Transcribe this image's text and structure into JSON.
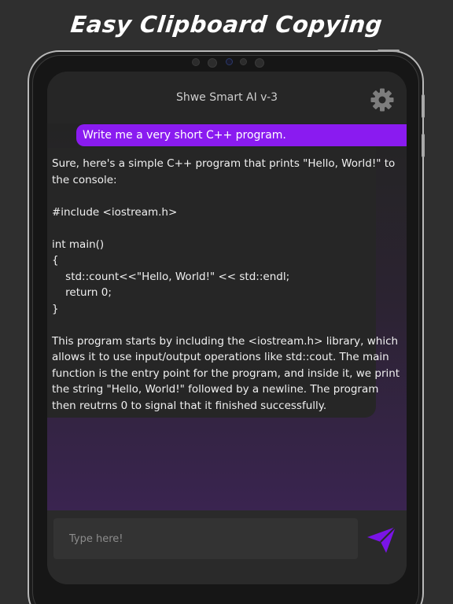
{
  "headline": "Easy Clipboard Copying",
  "app": {
    "title": "Shwe Smart AI v-3"
  },
  "icons": {
    "settings": "gear-icon",
    "send": "paper-plane-icon"
  },
  "colors": {
    "accent": "#8a1bf0",
    "send_icon": "#7a14e6",
    "background": "#2f2f2f",
    "screen": "#242424"
  },
  "chat": {
    "messages": [
      {
        "role": "user",
        "text": "Write me a very short C++ program."
      },
      {
        "role": "assistant",
        "lines": [
          "Sure, here's a simple C++ program that prints \"Hello, World!\" to",
          "the console:",
          "",
          "#include <iostream.h>",
          "",
          "int main()",
          "{",
          "    std::count<<\"Hello, World!\" << std::endl;",
          "    return 0;",
          "}",
          "",
          "This program starts by including the <iostream.h> library, which",
          "allows it to use input/output operations like std::cout. The main",
          "function is the entry point for the program, and inside it, we print",
          "the string \"Hello, World!\" followed by a newline. The program",
          "then reutrns 0 to signal that it finished successfully."
        ]
      }
    ]
  },
  "composer": {
    "placeholder": "Type here!",
    "value": ""
  }
}
